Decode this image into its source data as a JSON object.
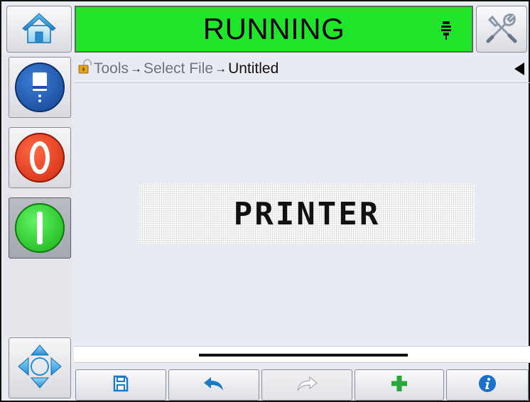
{
  "header": {
    "status_text": "RUNNING",
    "status_color": "#1fe62a"
  },
  "icons": {
    "home": "home-icon",
    "tools": "tools-icon",
    "status": "printhead-icon",
    "lock": "lock-icon",
    "ink": "ink-icon",
    "stop": "stop-icon",
    "start": "start-icon",
    "navigation": "navigation-arrows-icon",
    "save": "save-icon",
    "undo": "undo-icon",
    "redo": "redo-icon",
    "add": "add-icon",
    "info": "info-icon"
  },
  "breadcrumb": {
    "items": [
      "Tools",
      "Select File",
      "Untitled"
    ]
  },
  "preview": {
    "text": "PRINTER"
  },
  "colors": {
    "stop_red": "#e8381c",
    "start_green": "#2bd92b",
    "ink_blue": "#1e4fa8",
    "nav_blue": "#3aa6e8",
    "add_green": "#2aa63a",
    "info_blue": "#1e6fc7"
  }
}
